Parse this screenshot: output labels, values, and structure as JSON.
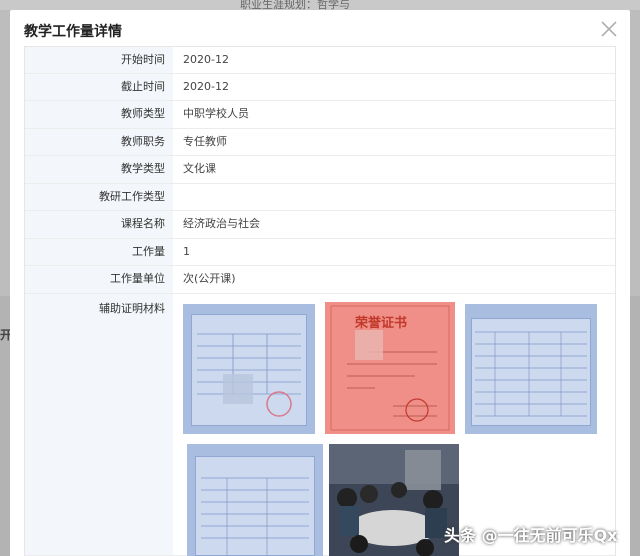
{
  "background": {
    "top_text": "职业生涯规划：哲学与",
    "left_text": "开"
  },
  "modal": {
    "title": "教学工作量详情",
    "close_icon": "close-icon"
  },
  "fields": [
    {
      "label": "开始时间",
      "value": "2020-12"
    },
    {
      "label": "截止时间",
      "value": "2020-12"
    },
    {
      "label": "教师类型",
      "value": "中职学校人员"
    },
    {
      "label": "教师职务",
      "value": "专任教师"
    },
    {
      "label": "教学类型",
      "value": "文化课"
    },
    {
      "label": "教研工作类型",
      "value": ""
    },
    {
      "label": "课程名称",
      "value": "经济政治与社会"
    },
    {
      "label": "工作量",
      "value": "1"
    },
    {
      "label": "工作量单位",
      "value": "次(公开课)"
    }
  ],
  "attachments": {
    "label": "辅助证明材料",
    "cert_title": "荣誉证书"
  },
  "watermark": "头条 @一往无前可乐Qx",
  "colors": {
    "label_bg": "#f3f6fa",
    "border": "#e6e6e6",
    "overlay": "#bdbdbd"
  }
}
